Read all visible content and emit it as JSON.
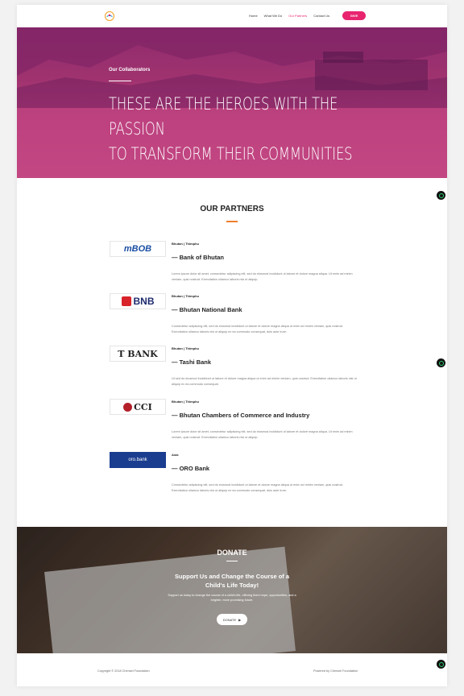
{
  "header": {
    "nav": [
      "Home",
      "What We Do",
      "Our Partners",
      "Contact Us"
    ],
    "active_nav": "Our Partners",
    "give_label": "GIVE"
  },
  "hero": {
    "kicker": "Our Collaborators",
    "title_line1": "THESE ARE THE HEROES WITH THE PASSION",
    "title_line2": "TO TRANSFORM THEIR COMMUNITIES"
  },
  "partners": {
    "title": "OUR PARTNERS",
    "items": [
      {
        "location": "Bhutan | Thimphu",
        "name": "— Bank of Bhutan",
        "logo_text": "mBOB",
        "desc": "Lorem ipsum dolor sit amet, consectetur adipiscing elit, sed do eiusmod incididunt ut labore et dolore magna aliqua. Ut enim ad minim veniam, quis nostrud. Exercitation ullamco laboris nisi ut aliquip."
      },
      {
        "location": "Bhutan | Thimphu",
        "name": "— Bhutan National Bank",
        "logo_text": "BNB",
        "desc": "Consectetur adipiscing elit, sed do eiusmod incididunt ut labore et dolore magna aliqua ut enim ad minim veniam, quis nostrud. Exercitation ullamco laboris nisi ut aliquip ex ea commodo consequat, duis aute irure."
      },
      {
        "location": "Bhutan | Thimphu",
        "name": "— Tashi Bank",
        "logo_text": "T BANK",
        "desc": "Ut sed do eiusmod incididunt ut labore et dolore magna aliqua ut enim ad minim veniam, quis nostrud. Exercitation ullamco laboris nisi ut aliquip ex ea commodo consequat."
      },
      {
        "location": "Bhutan | Thimphu",
        "name": "— Bhutan Chambers of Commerce and Industry",
        "logo_text": "CCI",
        "desc": "Lorem ipsum dolor sit amet, consectetur adipiscing elit, sed do eiusmod incididunt ut labore et dolore magna aliqua. Ut enim ad minim veniam, quis nostrud. Exercitation ullamco laboris nisi ut aliquip."
      },
      {
        "location": "Asia",
        "name": "— ORO Bank",
        "logo_text": "oro.bank",
        "desc": "Consectetur adipiscing elit, sed do eiusmod incididunt ut labore et dolore magna aliqua ut enim ad minim veniam, quis nostrud. Exercitation ullamco laboris nisi ut aliquip ex ea commodo consequat, duis aute irure."
      }
    ]
  },
  "donate": {
    "title": "DONATE",
    "subtitle_line1": "Support Us and Change the Course of a",
    "subtitle_line2": "Child's Life Today!",
    "text": "Support us today to change the course of a child's life, offering them hope, opportunities, and a brighter, more promising future.",
    "button_label": "DONATE"
  },
  "footer": {
    "copyright": "Copyright © 2018 Chensel Foundation",
    "powered": "Powered by Chensel Foundation"
  },
  "colors": {
    "accent": "#e8246f",
    "underline": "#ef7d2d",
    "hero": "#a0336f"
  }
}
